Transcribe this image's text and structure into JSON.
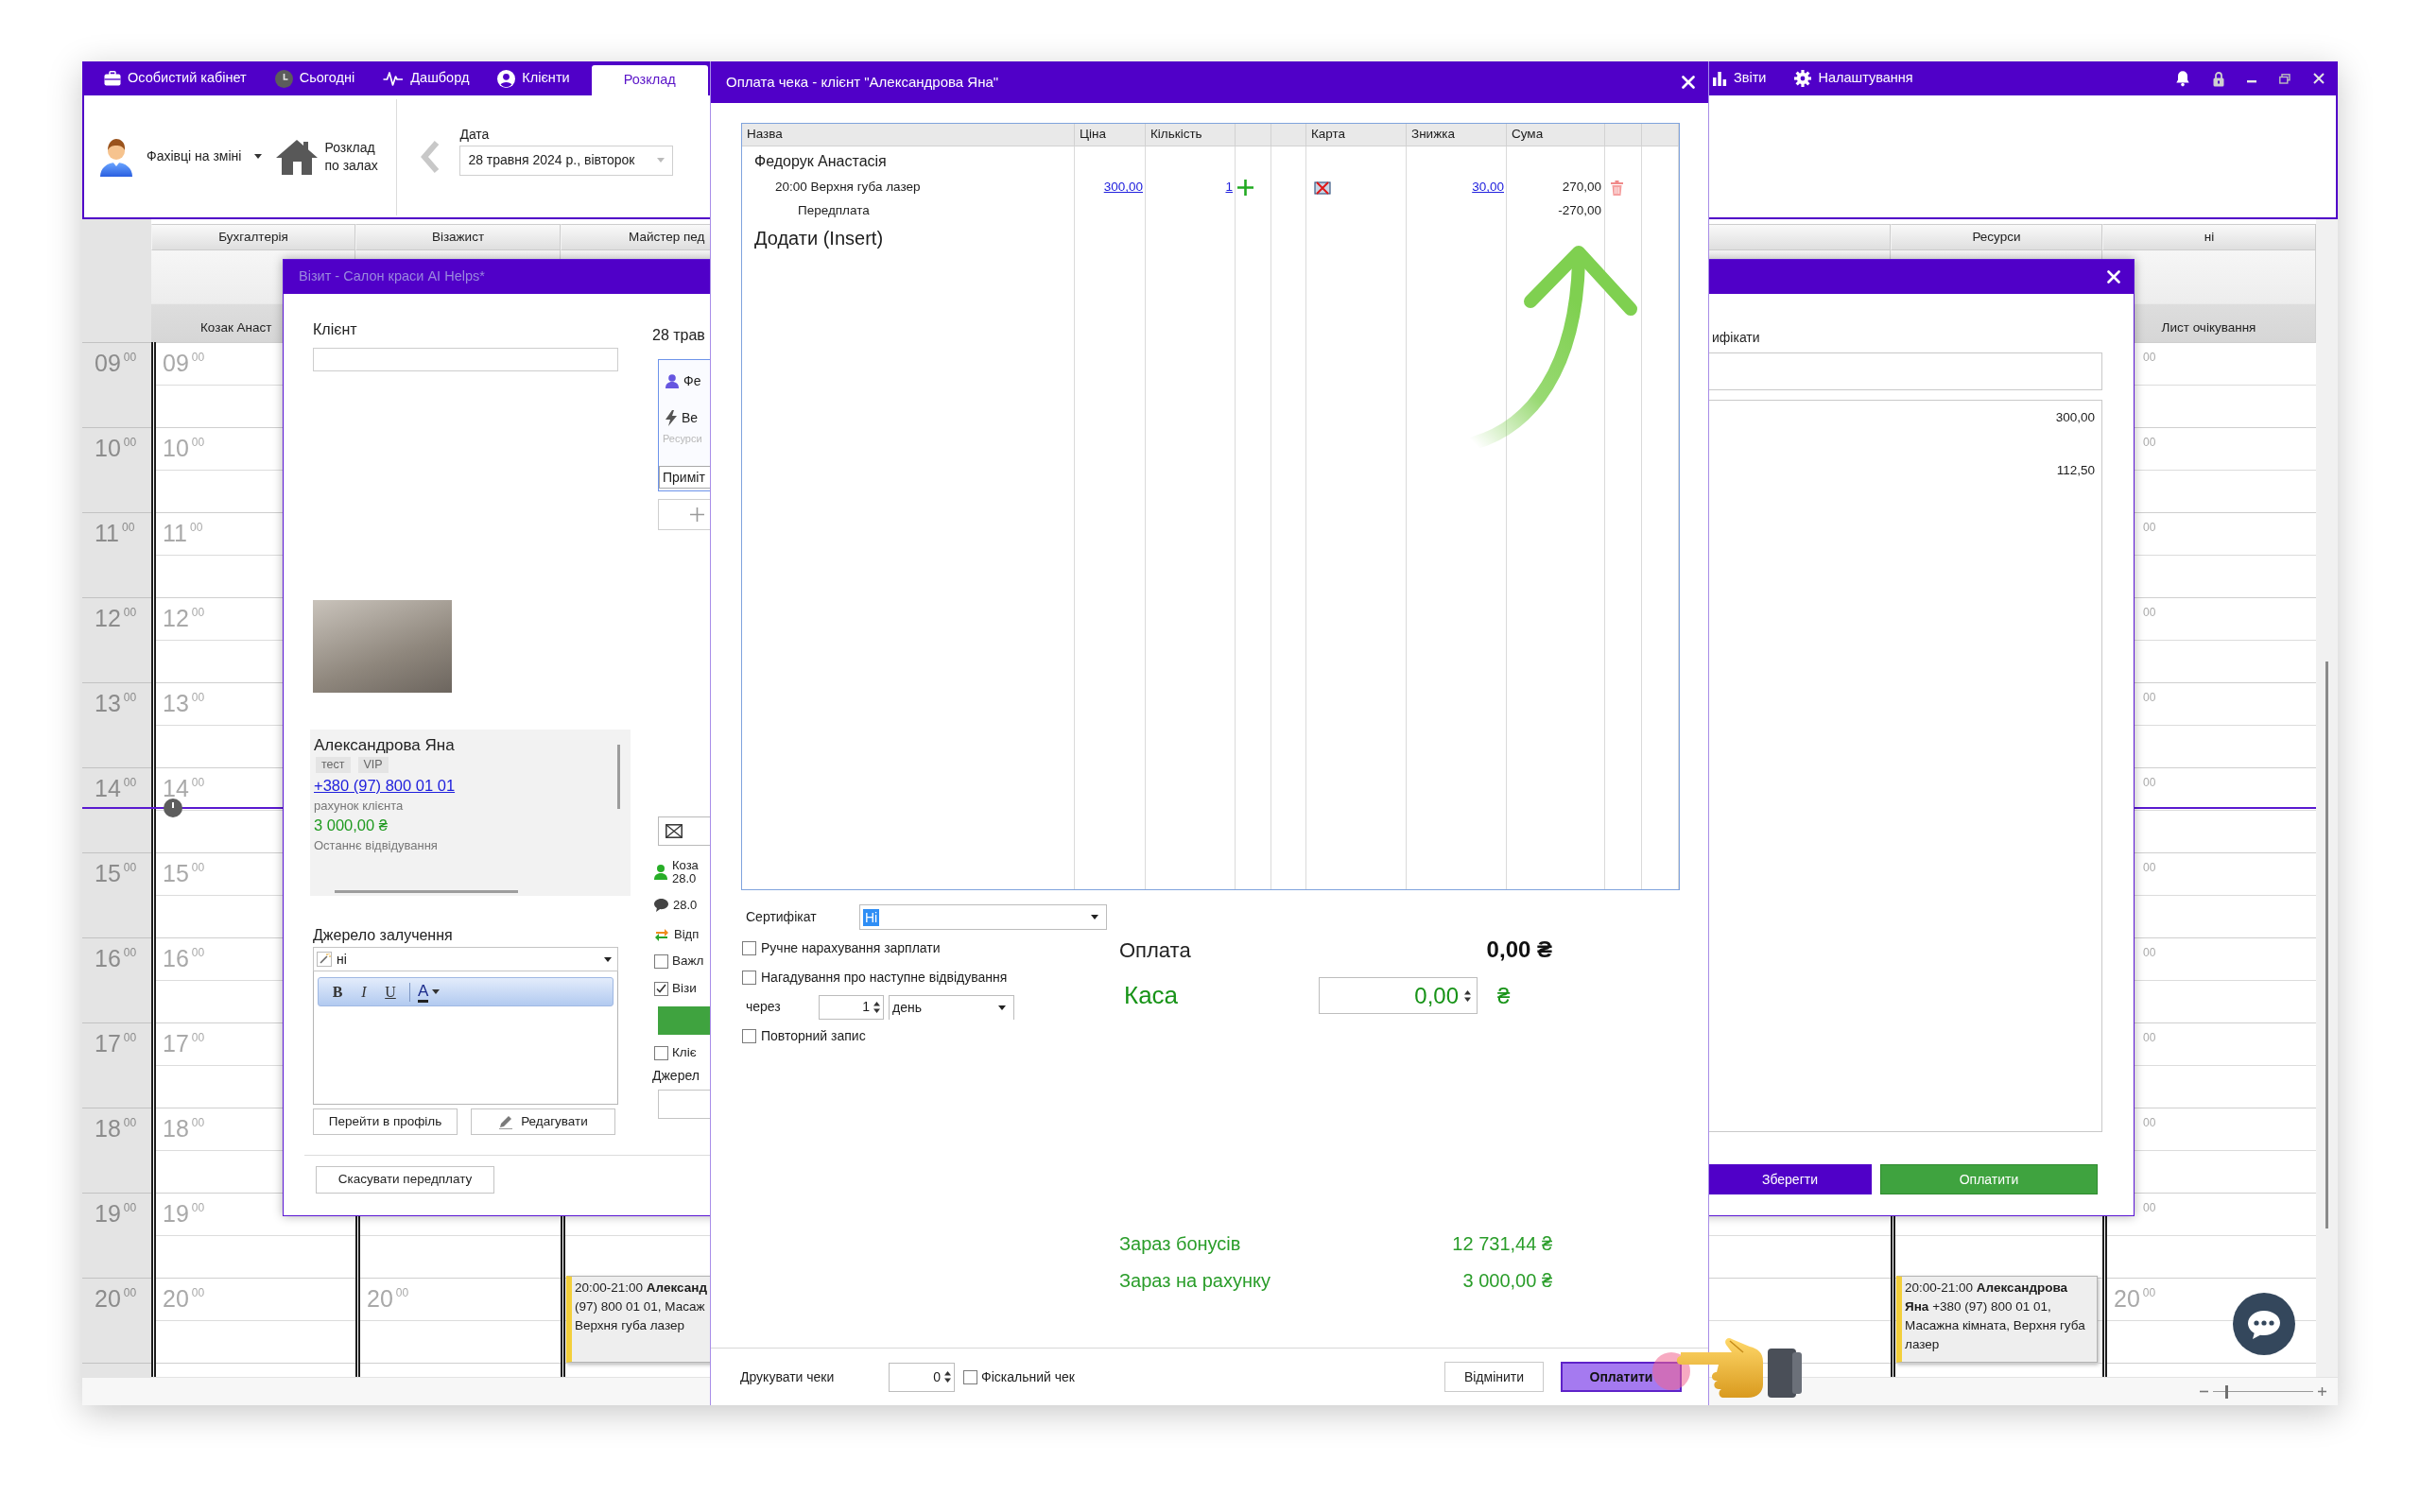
{
  "app": {
    "tabs": [
      {
        "label": "Особистий кабінет",
        "selected": false
      },
      {
        "label": "Сьогодні",
        "selected": false
      },
      {
        "label": "Дашборд",
        "selected": false
      },
      {
        "label": "Клієнти",
        "selected": false
      },
      {
        "label": "Розклад",
        "selected": true
      }
    ],
    "right_tabs": [
      {
        "label": "Звіти",
        "selected": false
      },
      {
        "label": "Налаштування",
        "selected": false
      }
    ]
  },
  "toolbar": {
    "staff_filter": "Фахівці на зміні",
    "halls_button": "Розклад по залах",
    "date_label": "Дата",
    "date_value": "28 травня 2024 р., вівторок"
  },
  "schedule": {
    "time_slots": [
      "09$^{00}$",
      "10$^{00}$",
      "11$^{00}$",
      "12$^{00}$",
      "13$^{00}$",
      "14$^{00}$",
      "15$^{00}$",
      "16$^{00}$",
      "17$^{00}$",
      "18$^{00}$",
      "19$^{00}$",
      "20$^{00}$"
    ],
    "left_columns": [
      {
        "group": "Бухгалтерія",
        "name": "Козак Анаст",
        "cells": [
          {
            "kind": "faint",
            "text": "09$^{00}$"
          },
          {
            "kind": "faint",
            "text": "10$^{00}$"
          },
          {
            "kind": "faint",
            "text": "11$^{00}$"
          },
          {
            "kind": "faint",
            "text": "12$^{00}$"
          },
          {
            "kind": "faint",
            "text": "13$^{00}$"
          },
          {
            "kind": "faint",
            "text": "14$^{00}$"
          },
          {
            "kind": "faint",
            "text": "15$^{00}$"
          },
          {
            "kind": "faint",
            "text": "16$^{00}$"
          },
          {
            "kind": "faint",
            "text": "17$^{00}$"
          },
          {
            "kind": "faint",
            "text": "18$^{00}$"
          },
          {
            "kind": "faint",
            "text": "19$^{00}$"
          },
          {
            "kind": "faint",
            "text": "20$^{00}$"
          }
        ]
      },
      {
        "group": "Візажист",
        "cells": [
          null,
          null,
          null,
          null,
          null,
          null,
          null,
          null,
          null,
          null,
          null,
          {
            "kind": "faint",
            "text": "20$^{00}$"
          }
        ]
      },
      {
        "group": "Майстер пед",
        "cells": [
          null,
          null,
          null,
          null,
          null,
          null,
          null,
          null,
          null,
          null,
          null,
          {
            "kind": "appointment",
            "text": "20:00-21:00 **Александ**\n(97) 800 01 01, Масаж\nВерхня губа лазер"
          }
        ]
      }
    ],
    "right_columns": [
      {
        "group": "Ресурси",
        "cells": [
          null,
          null,
          null,
          null,
          null,
          null,
          null,
          null,
          null,
          null,
          null,
          {
            "kind": "appointment",
            "text": "20:00-21:00 **Александрова Яна** +380 (97) 800 01 01, Масажна кімната, Верхня губа лазер"
          }
        ]
      },
      {
        "group": "ні",
        "name": "Лист очікування",
        "cells": [
          {
            "kind": "faint_cut",
            "text": "$^{00}$"
          },
          {
            "kind": "faint_cut",
            "text": "$^{00}$"
          },
          {
            "kind": "faint_cut",
            "text": "$^{00}$"
          },
          {
            "kind": "faint_cut",
            "text": "$^{00}$"
          },
          {
            "kind": "faint_cut",
            "text": "$^{00}$"
          },
          {
            "kind": "faint_cut",
            "text": "$^{00}$"
          },
          {
            "kind": "faint_cut",
            "text": "$^{00}$"
          },
          {
            "kind": "faint_cut",
            "text": "$^{00}$"
          },
          {
            "kind": "faint_cut",
            "text": "$^{00}$"
          },
          {
            "kind": "faint_cut",
            "text": "$^{00}$"
          },
          {
            "kind": "faint_cut",
            "text": "$^{00}$"
          },
          {
            "kind": "faint",
            "text": "20$^{00}$"
          }
        ]
      }
    ]
  },
  "status_bar": {
    "zoom_slider": {
      "level": 0.12
    }
  },
  "visit_dialog": {
    "title": "Візит - Салон краси AI Helps*",
    "client_label": "Клієнт",
    "client": {
      "name": "Александрова Яна",
      "tags": [
        "тест",
        "VIP"
      ],
      "phone": "+380 (97) 800 01 01",
      "balance_label": "рахунок клієнта",
      "balance": "3 000,00 ₴",
      "last_visit_label": "Останнє відвідування"
    },
    "source_label": "Джерело залучення",
    "source_value": "ні",
    "editor_buttons": [
      {
        "kind": "bold",
        "label": "B"
      },
      {
        "kind": "italic",
        "label": "I"
      },
      {
        "kind": "underline",
        "label": "U"
      },
      {
        "kind": "color",
        "label": "A"
      }
    ],
    "profile_button": "Перейти в профіль",
    "edit_button": "Редагувати",
    "cancel_prepayment_button": "Скасувати передплату",
    "visit_date": "28 трав",
    "visit_card": {
      "staff": "Фе",
      "service": "Ве",
      "resources": "Ресурси",
      "note": "Приміт"
    },
    "side_items": [
      {
        "kind": "mail_dropdown"
      },
      {
        "kind": "staff",
        "lines": [
          "Коза",
          "28.0"
        ]
      },
      {
        "kind": "comment",
        "text": "28.0"
      },
      {
        "kind": "transfer",
        "text": "Відп"
      },
      {
        "kind": "checkbox",
        "label": "Важл",
        "checked": false
      },
      {
        "kind": "checkbox",
        "label": "Візи",
        "checked": true
      },
      {
        "kind": "green_button"
      },
      {
        "kind": "checkbox",
        "label": "Кліє",
        "checked": false
      },
      {
        "kind": "label",
        "text": "Джерел"
      },
      {
        "kind": "field"
      }
    ],
    "right_panel": {
      "label": "ифікати",
      "amounts": [
        "300,00",
        "112,50"
      ],
      "save_button": "Зберегти",
      "pay_button": "Оплатити"
    }
  },
  "payment_dialog": {
    "title": "Оплата чека - клієнт \"Александрова Яна\"",
    "columns": [
      "Назва",
      "Ціна",
      "Кількість",
      "Карта",
      "Знижка",
      "Сума"
    ],
    "group": "Федорук Анастасія",
    "items": [
      {
        "kind": "service",
        "name": "20:00 Верхня губа лазер",
        "price": "300,00",
        "quantity": "1",
        "discount": "30,00",
        "sum": "270,00"
      },
      {
        "kind": "prepayment",
        "name": "Передплата",
        "sum": "-270,00"
      }
    ],
    "add_link": "Додати (Insert)",
    "certificate_label": "Сертифікат",
    "certificate_value": "Ні",
    "options": [
      {
        "kind": "checkbox",
        "label": "Ручне нарахування зарплати",
        "checked": false
      },
      {
        "kind": "checkbox",
        "label": "Нагадування про наступне відвідування",
        "checked": false
      },
      {
        "kind": "interval",
        "label": "через",
        "value": "1",
        "unit": "день"
      },
      {
        "kind": "checkbox",
        "label": "Повторний запис",
        "checked": false
      }
    ],
    "payment_label": "Оплата",
    "payment_total": "0,00 ₴",
    "cash_label": "Каса",
    "cash_value": "0,00",
    "cash_currency": "₴",
    "balances": [
      {
        "label": "Зараз бонусів",
        "value": "12 731,44 ₴"
      },
      {
        "label": "Зараз на рахунку",
        "value": "3 000,00 ₴"
      }
    ],
    "print_label": "Друкувати чеки",
    "print_count": "0",
    "fiscal": {
      "label": "Фіскальний чек",
      "checked": false
    },
    "cancel_button": "Відмінити",
    "pay_button": "Оплатити"
  }
}
